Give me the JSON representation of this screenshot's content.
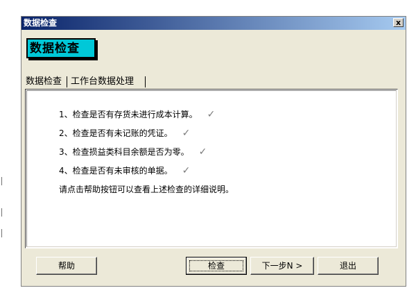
{
  "window": {
    "title": "数据检查",
    "close_label": "x"
  },
  "header": {
    "badge_label": "数据检查"
  },
  "tabs": [
    {
      "label": "数据检查"
    },
    {
      "label": "工作台数据处理"
    }
  ],
  "checks": [
    {
      "text": "1、检查是否有存货未进行成本计算。",
      "icon": "checkmark-icon"
    },
    {
      "text": "2、检查是否有未记账的凭证。",
      "icon": "checkmark-icon"
    },
    {
      "text": "3、检查损益类科目余额是否为零。",
      "icon": "checkmark-icon"
    },
    {
      "text": "4、检查是否有未审核的单据。",
      "icon": "checkmark-icon"
    }
  ],
  "hint": "请点击帮助按钮可以查看上述检查的详细说明。",
  "buttons": {
    "help": "帮助",
    "check": "检查",
    "next": "下一步N >",
    "exit": "退出"
  },
  "colors": {
    "title_gradient_start": "#0a246a",
    "title_gradient_end": "#a6caf0",
    "badge_fill": "#00c8d8",
    "window_face": "#ece9d8"
  }
}
